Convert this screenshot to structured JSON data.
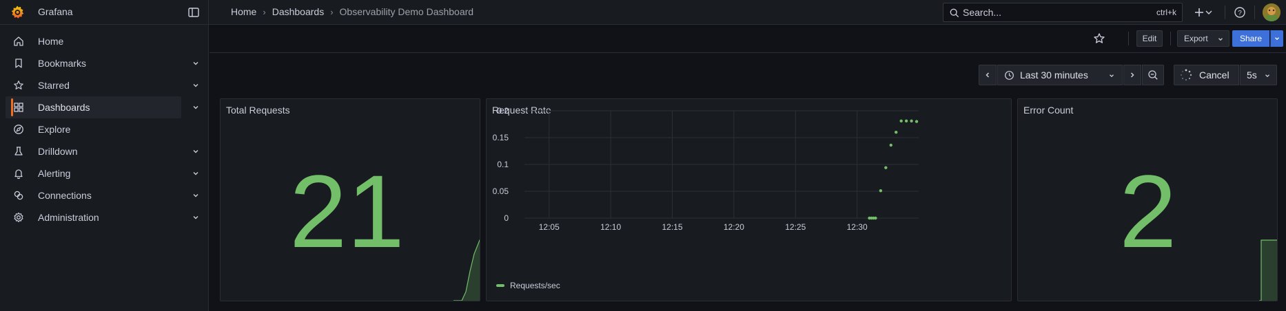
{
  "app": {
    "name": "Grafana"
  },
  "sidebar": {
    "items": [
      {
        "label": "Home",
        "icon": "home-icon",
        "expandable": false,
        "active": false
      },
      {
        "label": "Bookmarks",
        "icon": "bookmark-icon",
        "expandable": true,
        "active": false
      },
      {
        "label": "Starred",
        "icon": "star-icon",
        "expandable": true,
        "active": false
      },
      {
        "label": "Dashboards",
        "icon": "apps-icon",
        "expandable": true,
        "active": true
      },
      {
        "label": "Explore",
        "icon": "compass-icon",
        "expandable": false,
        "active": false
      },
      {
        "label": "Drilldown",
        "icon": "drilldown-icon",
        "expandable": true,
        "active": false
      },
      {
        "label": "Alerting",
        "icon": "bell-icon",
        "expandable": true,
        "active": false
      },
      {
        "label": "Connections",
        "icon": "link-icon",
        "expandable": true,
        "active": false
      },
      {
        "label": "Administration",
        "icon": "gear-icon",
        "expandable": true,
        "active": false
      }
    ]
  },
  "breadcrumb": {
    "home": "Home",
    "dashboards": "Dashboards",
    "current": "Observability Demo Dashboard"
  },
  "search": {
    "placeholder": "Search...",
    "shortcut": "ctrl+k"
  },
  "toolbar": {
    "edit": "Edit",
    "export": "Export",
    "share": "Share"
  },
  "timepicker": {
    "range": "Last 30 minutes",
    "cancel": "Cancel",
    "refresh": "5s"
  },
  "colors": {
    "accent": "#f56e20",
    "green": "#73bf69",
    "primary": "#3d71d9"
  },
  "panels": {
    "total_requests": {
      "title": "Total Requests",
      "value": "21"
    },
    "request_rate": {
      "title": "Request Rate"
    },
    "error_count": {
      "title": "Error Count",
      "value": "2"
    }
  },
  "chart_data": {
    "type": "scatter",
    "title": "Request Rate",
    "xlabel": "",
    "ylabel": "",
    "x_ticks": [
      "12:05",
      "12:10",
      "12:15",
      "12:20",
      "12:25",
      "12:30"
    ],
    "y_ticks": [
      "0",
      "0.05",
      "0.1",
      "0.15",
      "0.2"
    ],
    "ylim": [
      0,
      0.2
    ],
    "grid": true,
    "legend": "bottom-left",
    "series": [
      {
        "name": "Requests/sec",
        "color": "#73bf69",
        "points": [
          {
            "x": "12:31:00",
            "y": 0
          },
          {
            "x": "12:31:10",
            "y": 0
          },
          {
            "x": "12:31:20",
            "y": 0
          },
          {
            "x": "12:31:30",
            "y": 0
          },
          {
            "x": "12:31:55",
            "y": 0.051
          },
          {
            "x": "12:32:20",
            "y": 0.094
          },
          {
            "x": "12:32:45",
            "y": 0.136
          },
          {
            "x": "12:33:10",
            "y": 0.16
          },
          {
            "x": "12:33:35",
            "y": 0.181
          },
          {
            "x": "12:34:00",
            "y": 0.181
          },
          {
            "x": "12:34:25",
            "y": 0.181
          },
          {
            "x": "12:34:50",
            "y": 0.18
          }
        ]
      }
    ]
  }
}
